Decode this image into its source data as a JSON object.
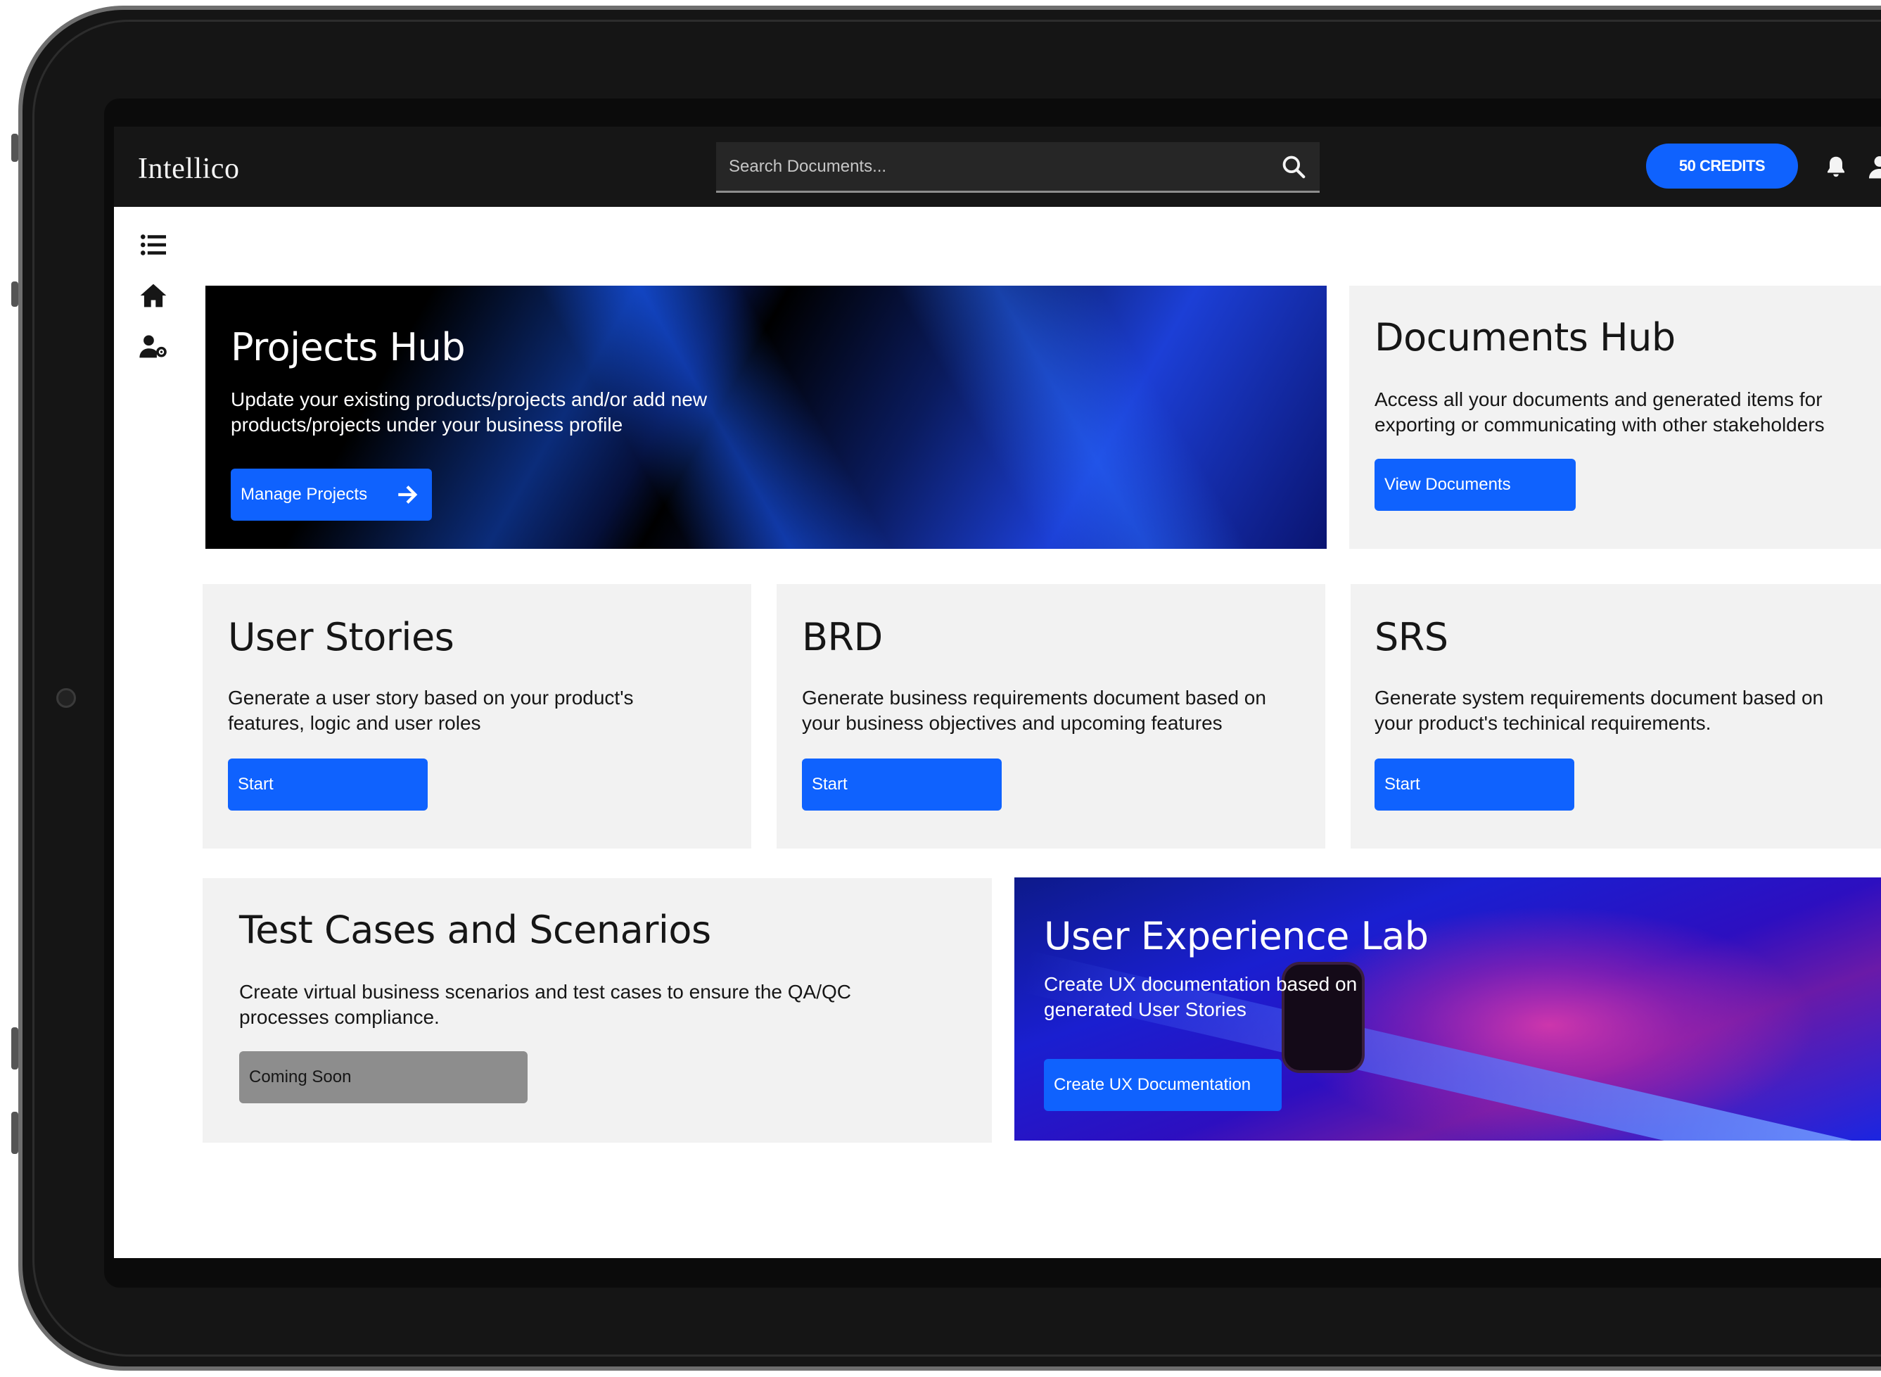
{
  "app": {
    "brand": "Intellico"
  },
  "search": {
    "placeholder": "Search Documents..."
  },
  "header": {
    "credits_label": "50 CREDITS"
  },
  "cards": {
    "projects_hub": {
      "title": "Projects Hub",
      "description": "Update your existing products/projects and/or add new products/projects under your business profile",
      "button_label": "Manage Projects"
    },
    "documents_hub": {
      "title": "Documents Hub",
      "description": "Access all your documents and generated items for exporting or communicating with other stakeholders",
      "button_label": "View Documents"
    },
    "user_stories": {
      "title": "User Stories",
      "description": "Generate a user story based on your product's features, logic and user roles",
      "button_label": "Start"
    },
    "brd": {
      "title": "BRD",
      "description": "Generate business requirements document based on your business objectives and upcoming features",
      "button_label": "Start"
    },
    "srs": {
      "title": "SRS",
      "description": "Generate system requirements document based on your product's techinical requirements.",
      "button_label": "Start"
    },
    "test_cases": {
      "title": "Test Cases and Scenarios",
      "description": "Create virtual business scenarios and test cases to ensure the QA/QC processes compliance.",
      "button_label": "Coming Soon"
    },
    "ux_lab": {
      "title": "User Experience Lab",
      "description": "Create UX documentation based on generated User Stories",
      "button_label": "Create UX Documentation"
    }
  },
  "icons": {
    "search": "search-icon",
    "bell": "bell-icon",
    "user": "user-icon",
    "menu": "list-icon",
    "home": "home-icon",
    "user_settings": "user-settings-icon",
    "arrow": "arrow-right-icon"
  },
  "colors": {
    "accent": "#0f62fe",
    "topbar": "#161616",
    "card": "#f2f2f2",
    "disabled": "#8d8d8d"
  }
}
